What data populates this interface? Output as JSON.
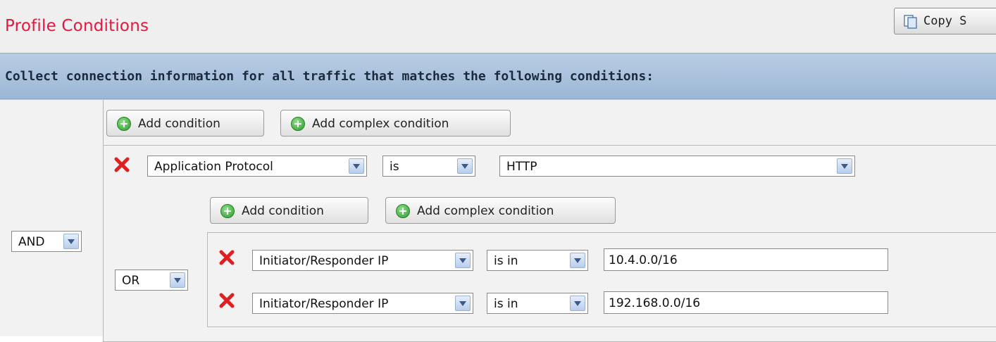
{
  "page": {
    "title": "Profile Conditions"
  },
  "toolbar": {
    "copy_label": "Copy S"
  },
  "banner": {
    "text": "Collect connection information for all traffic that matches the following conditions:"
  },
  "colors": {
    "title": "#e5173f",
    "banner": "#a9c2de",
    "remove": "#e02020",
    "add": "#2b9b2b"
  },
  "root": {
    "operator": "AND",
    "add_condition_label": "Add condition",
    "add_complex_label": "Add complex condition",
    "condition": {
      "field": "Application Protocol",
      "operator": "is",
      "value": "HTTP"
    },
    "nested": {
      "operator": "OR",
      "add_condition_label": "Add condition",
      "add_complex_label": "Add complex condition",
      "conditions": [
        {
          "field": "Initiator/Responder IP",
          "operator": "is in",
          "value": "10.4.0.0/16"
        },
        {
          "field": "Initiator/Responder IP",
          "operator": "is in",
          "value": "192.168.0.0/16"
        }
      ]
    }
  },
  "icons": {
    "remove": "remove-x-icon",
    "add": "add-plus-icon",
    "copy": "copy-icon",
    "dropdown": "chevron-down-icon"
  }
}
